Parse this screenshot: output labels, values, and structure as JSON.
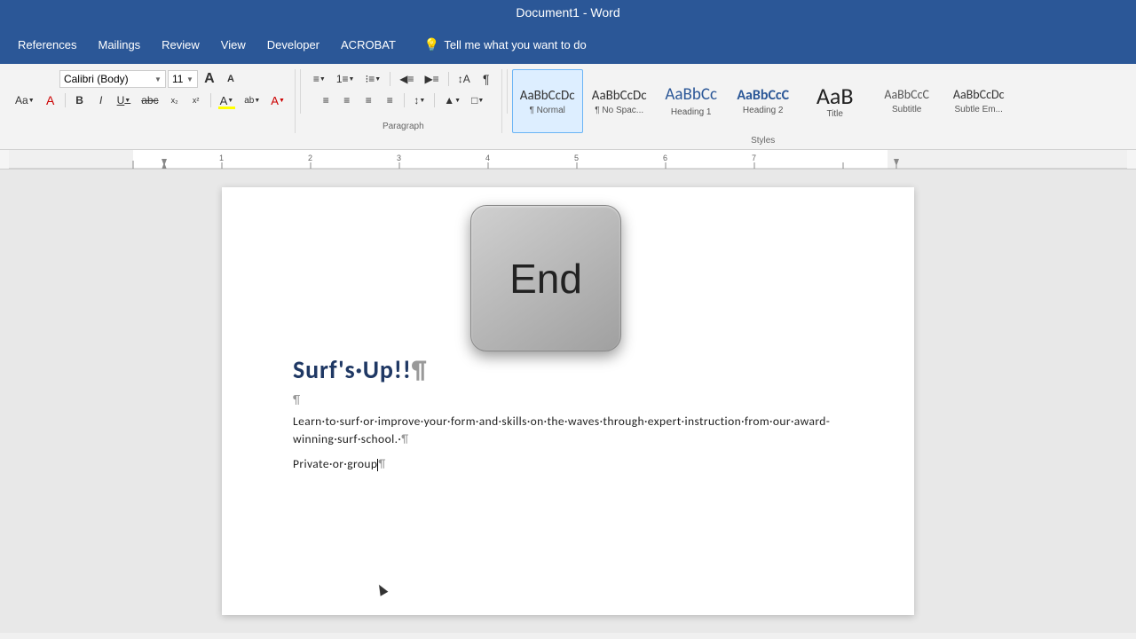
{
  "titlebar": {
    "text": "Document1  -  Word"
  },
  "menubar": {
    "items": [
      "References",
      "Mailings",
      "Review",
      "View",
      "Developer",
      "ACROBAT"
    ],
    "tellme": "Tell me what you want to do"
  },
  "ribbon": {
    "font": {
      "name": "Calibri (Body)",
      "size": "11",
      "grow_label": "A",
      "shrink_label": "A"
    },
    "paragraph_label": "Paragraph",
    "styles_label": "Styles",
    "styles": [
      {
        "id": "normal",
        "preview": "AaBbCcDc",
        "label": "¶ Normal",
        "active": true
      },
      {
        "id": "nospace",
        "preview": "AaBbCcDc",
        "label": "¶ No Spac...",
        "active": false
      },
      {
        "id": "h1",
        "preview": "AaBbCc",
        "label": "Heading 1",
        "active": false
      },
      {
        "id": "h2",
        "preview": "AaBbCcC",
        "label": "Heading 2",
        "active": false
      },
      {
        "id": "title",
        "preview": "AaB",
        "label": "Title",
        "active": false
      },
      {
        "id": "subtitle",
        "preview": "AaBbCcC",
        "label": "Subtitle",
        "active": false
      },
      {
        "id": "subtle",
        "preview": "AaBbCcDc",
        "label": "Subtle Em...",
        "active": false
      }
    ]
  },
  "ruler": {
    "visible": true
  },
  "document": {
    "surf_line": "Surf's·Up!!¶",
    "blank_line": "¶",
    "para_line": "Learn·to·surf·or·improve·your·form·and·skills·on·the·waves·through·expert·instruction·from·our·award-winning·surf·school.·¶",
    "partial_line": "Private·or·group"
  },
  "endkey": {
    "label": "End"
  }
}
